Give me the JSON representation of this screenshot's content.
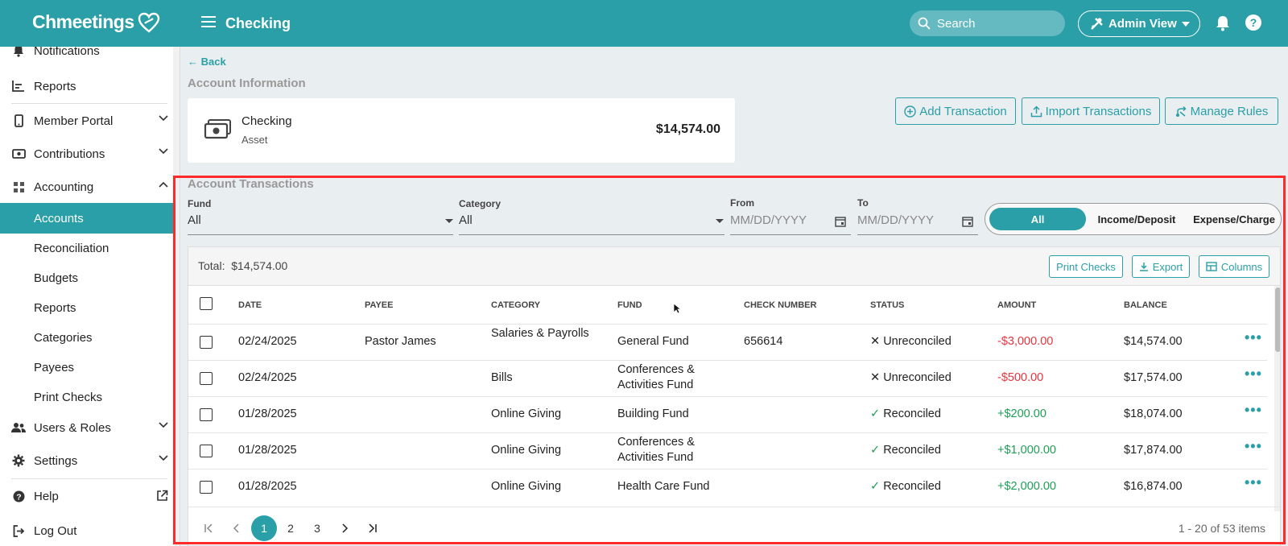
{
  "app": {
    "name": "Chmeetings",
    "page_title": "Checking"
  },
  "topbar": {
    "search_placeholder": "Search",
    "admin_label": "Admin View"
  },
  "sidebar": {
    "notifications": "Notifications",
    "reports_top": "Reports",
    "member_portal": "Member Portal",
    "contributions": "Contributions",
    "accounting": "Accounting",
    "accounts": "Accounts",
    "reconciliation": "Reconciliation",
    "budgets": "Budgets",
    "reports_sub": "Reports",
    "categories": "Categories",
    "payees": "Payees",
    "print_checks": "Print Checks",
    "users_roles": "Users & Roles",
    "settings": "Settings",
    "help": "Help",
    "logout": "Log Out"
  },
  "main": {
    "back": "Back",
    "account_info_title": "Account Information",
    "account": {
      "name": "Checking",
      "type": "Asset",
      "balance": "$14,574.00"
    },
    "buttons": {
      "add": "Add Transaction",
      "import": "Import Transactions",
      "rules": "Manage Rules"
    },
    "transactions_title": "Account Transactions"
  },
  "filters": {
    "fund_label": "Fund",
    "fund_value": "All",
    "category_label": "Category",
    "category_value": "All",
    "from_label": "From",
    "from_placeholder": "MM/DD/YYYY",
    "to_label": "To",
    "to_placeholder": "MM/DD/YYYY",
    "toggle": {
      "all": "All",
      "income": "Income/Deposit",
      "expense": "Expense/Charge"
    }
  },
  "table": {
    "total_label": "Total:",
    "total_value": "$14,574.00",
    "print_checks": "Print Checks",
    "export": "Export",
    "columns": "Columns",
    "headers": {
      "date": "DATE",
      "payee": "PAYEE",
      "category": "CATEGORY",
      "fund": "FUND",
      "check": "CHECK NUMBER",
      "status": "STATUS",
      "amount": "AMOUNT",
      "balance": "BALANCE"
    },
    "rows": [
      {
        "date": "02/24/2025",
        "payee": "Pastor James",
        "category": "Salaries & Payrolls",
        "fund": "General Fund",
        "check": "656614",
        "status": "Unreconciled",
        "amount": "-$3,000.00",
        "balance": "$14,574.00"
      },
      {
        "date": "02/24/2025",
        "payee": "",
        "category": "Bills",
        "fund": "Conferences & Activities Fund",
        "check": "",
        "status": "Unreconciled",
        "amount": "-$500.00",
        "balance": "$17,574.00"
      },
      {
        "date": "01/28/2025",
        "payee": "",
        "category": "Online Giving",
        "fund": "Building Fund",
        "check": "",
        "status": "Reconciled",
        "amount": "+$200.00",
        "balance": "$18,074.00"
      },
      {
        "date": "01/28/2025",
        "payee": "",
        "category": "Online Giving",
        "fund": "Conferences & Activities Fund",
        "check": "",
        "status": "Reconciled",
        "amount": "+$1,000.00",
        "balance": "$17,874.00"
      },
      {
        "date": "01/28/2025",
        "payee": "",
        "category": "Online Giving",
        "fund": "Health Care Fund",
        "check": "",
        "status": "Reconciled",
        "amount": "+$2,000.00",
        "balance": "$16,874.00"
      }
    ],
    "pager": {
      "p1": "1",
      "p2": "2",
      "p3": "3",
      "info": "1 - 20 of 53 items"
    }
  },
  "colors": {
    "brand": "#2a9fa8",
    "negative": "#e8343f",
    "positive": "#1f9d57",
    "highlight": "#ff2b2b"
  }
}
